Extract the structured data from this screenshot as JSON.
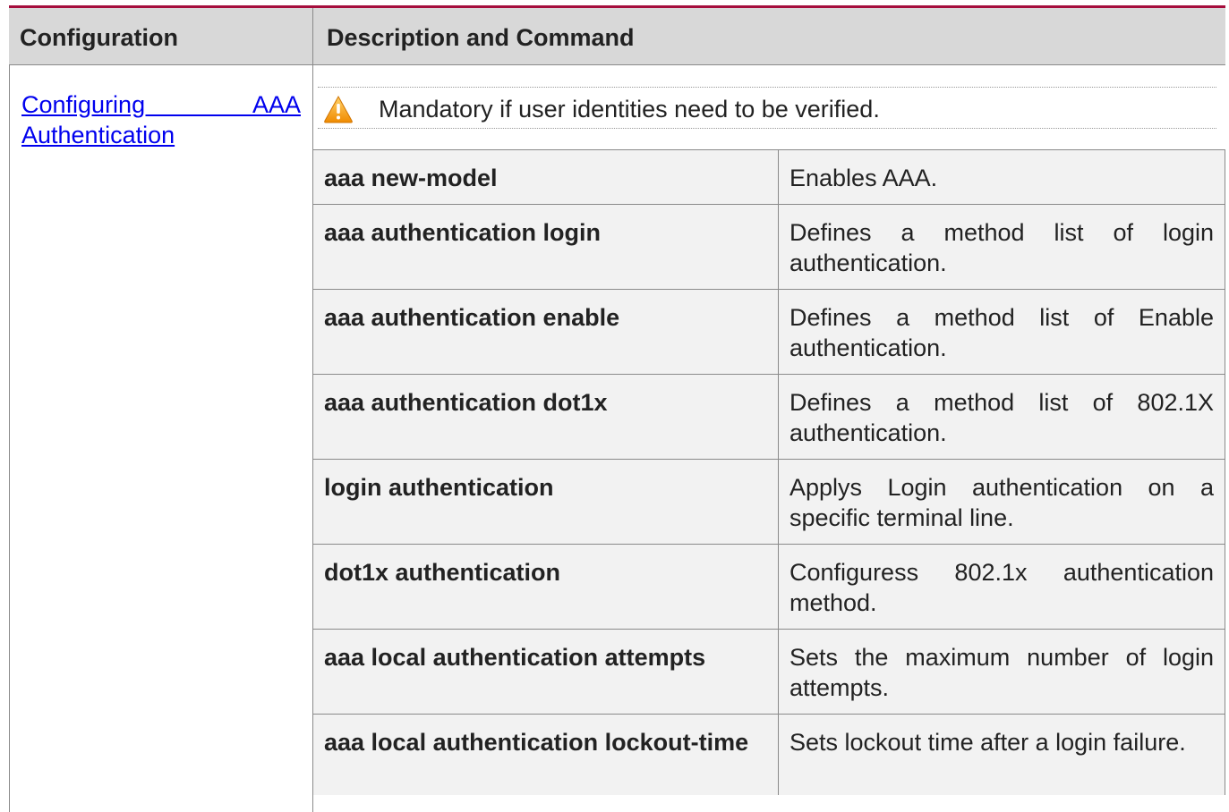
{
  "table": {
    "headers": {
      "configuration": "Configuration",
      "description": "Description and Command"
    },
    "section": {
      "link_line1": "Configuring AAA",
      "link_line2": "Authentication",
      "note_icon": "warning-icon",
      "note_text": "Mandatory if user identities need to be verified.",
      "rows": [
        {
          "command": "aaa new-model",
          "description": "Enables AAA."
        },
        {
          "command": "aaa authentication login",
          "description": "Defines a method list of login authentication."
        },
        {
          "command": "aaa authentication enable",
          "description": "Defines a method list of Enable authentication."
        },
        {
          "command": "aaa authentication dot1x",
          "description": "Defines a method list of 802.1X authentication."
        },
        {
          "command": "login authentication",
          "description": "Applys Login authentication on a specific terminal line."
        },
        {
          "command": "dot1x authentication",
          "description": "Configuress 802.1x authentication method."
        },
        {
          "command": "aaa local authentication attempts",
          "description": "Sets the maximum number of login attempts."
        },
        {
          "command": "aaa local authentication lockout-time",
          "description": "Sets lockout time after a login failure."
        }
      ]
    }
  },
  "colors": {
    "top_rule": "#a50d3c",
    "header_bg": "#d8d8d8",
    "row_bg": "#f2f2f2",
    "link": "#0000ee",
    "warning": "#f5a623"
  }
}
